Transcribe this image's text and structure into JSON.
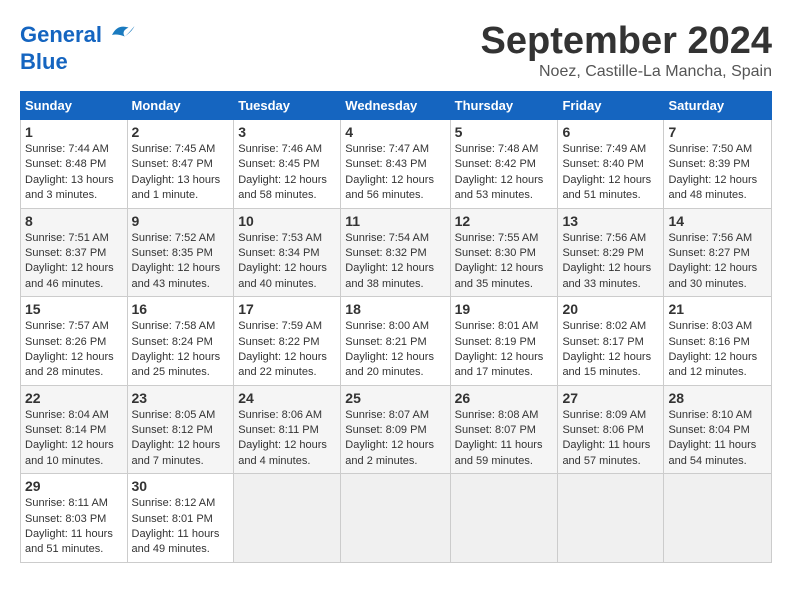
{
  "header": {
    "logo_line1": "General",
    "logo_line2": "Blue",
    "month_title": "September 2024",
    "location": "Noez, Castille-La Mancha, Spain"
  },
  "days_of_week": [
    "Sunday",
    "Monday",
    "Tuesday",
    "Wednesday",
    "Thursday",
    "Friday",
    "Saturday"
  ],
  "weeks": [
    [
      {
        "day": "1",
        "info": "Sunrise: 7:44 AM\nSunset: 8:48 PM\nDaylight: 13 hours and 3 minutes."
      },
      {
        "day": "2",
        "info": "Sunrise: 7:45 AM\nSunset: 8:47 PM\nDaylight: 13 hours and 1 minute."
      },
      {
        "day": "3",
        "info": "Sunrise: 7:46 AM\nSunset: 8:45 PM\nDaylight: 12 hours and 58 minutes."
      },
      {
        "day": "4",
        "info": "Sunrise: 7:47 AM\nSunset: 8:43 PM\nDaylight: 12 hours and 56 minutes."
      },
      {
        "day": "5",
        "info": "Sunrise: 7:48 AM\nSunset: 8:42 PM\nDaylight: 12 hours and 53 minutes."
      },
      {
        "day": "6",
        "info": "Sunrise: 7:49 AM\nSunset: 8:40 PM\nDaylight: 12 hours and 51 minutes."
      },
      {
        "day": "7",
        "info": "Sunrise: 7:50 AM\nSunset: 8:39 PM\nDaylight: 12 hours and 48 minutes."
      }
    ],
    [
      {
        "day": "8",
        "info": "Sunrise: 7:51 AM\nSunset: 8:37 PM\nDaylight: 12 hours and 46 minutes."
      },
      {
        "day": "9",
        "info": "Sunrise: 7:52 AM\nSunset: 8:35 PM\nDaylight: 12 hours and 43 minutes."
      },
      {
        "day": "10",
        "info": "Sunrise: 7:53 AM\nSunset: 8:34 PM\nDaylight: 12 hours and 40 minutes."
      },
      {
        "day": "11",
        "info": "Sunrise: 7:54 AM\nSunset: 8:32 PM\nDaylight: 12 hours and 38 minutes."
      },
      {
        "day": "12",
        "info": "Sunrise: 7:55 AM\nSunset: 8:30 PM\nDaylight: 12 hours and 35 minutes."
      },
      {
        "day": "13",
        "info": "Sunrise: 7:56 AM\nSunset: 8:29 PM\nDaylight: 12 hours and 33 minutes."
      },
      {
        "day": "14",
        "info": "Sunrise: 7:56 AM\nSunset: 8:27 PM\nDaylight: 12 hours and 30 minutes."
      }
    ],
    [
      {
        "day": "15",
        "info": "Sunrise: 7:57 AM\nSunset: 8:26 PM\nDaylight: 12 hours and 28 minutes."
      },
      {
        "day": "16",
        "info": "Sunrise: 7:58 AM\nSunset: 8:24 PM\nDaylight: 12 hours and 25 minutes."
      },
      {
        "day": "17",
        "info": "Sunrise: 7:59 AM\nSunset: 8:22 PM\nDaylight: 12 hours and 22 minutes."
      },
      {
        "day": "18",
        "info": "Sunrise: 8:00 AM\nSunset: 8:21 PM\nDaylight: 12 hours and 20 minutes."
      },
      {
        "day": "19",
        "info": "Sunrise: 8:01 AM\nSunset: 8:19 PM\nDaylight: 12 hours and 17 minutes."
      },
      {
        "day": "20",
        "info": "Sunrise: 8:02 AM\nSunset: 8:17 PM\nDaylight: 12 hours and 15 minutes."
      },
      {
        "day": "21",
        "info": "Sunrise: 8:03 AM\nSunset: 8:16 PM\nDaylight: 12 hours and 12 minutes."
      }
    ],
    [
      {
        "day": "22",
        "info": "Sunrise: 8:04 AM\nSunset: 8:14 PM\nDaylight: 12 hours and 10 minutes."
      },
      {
        "day": "23",
        "info": "Sunrise: 8:05 AM\nSunset: 8:12 PM\nDaylight: 12 hours and 7 minutes."
      },
      {
        "day": "24",
        "info": "Sunrise: 8:06 AM\nSunset: 8:11 PM\nDaylight: 12 hours and 4 minutes."
      },
      {
        "day": "25",
        "info": "Sunrise: 8:07 AM\nSunset: 8:09 PM\nDaylight: 12 hours and 2 minutes."
      },
      {
        "day": "26",
        "info": "Sunrise: 8:08 AM\nSunset: 8:07 PM\nDaylight: 11 hours and 59 minutes."
      },
      {
        "day": "27",
        "info": "Sunrise: 8:09 AM\nSunset: 8:06 PM\nDaylight: 11 hours and 57 minutes."
      },
      {
        "day": "28",
        "info": "Sunrise: 8:10 AM\nSunset: 8:04 PM\nDaylight: 11 hours and 54 minutes."
      }
    ],
    [
      {
        "day": "29",
        "info": "Sunrise: 8:11 AM\nSunset: 8:03 PM\nDaylight: 11 hours and 51 minutes."
      },
      {
        "day": "30",
        "info": "Sunrise: 8:12 AM\nSunset: 8:01 PM\nDaylight: 11 hours and 49 minutes."
      },
      null,
      null,
      null,
      null,
      null
    ]
  ]
}
